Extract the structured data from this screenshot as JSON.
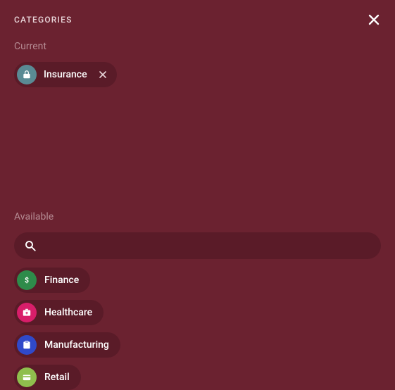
{
  "panel": {
    "title": "CATEGORIES"
  },
  "current": {
    "label": "Current",
    "items": [
      {
        "label": "Insurance",
        "icon": "lock",
        "color": "#5a8a94"
      }
    ]
  },
  "available": {
    "label": "Available",
    "search": {
      "value": "",
      "placeholder": ""
    },
    "items": [
      {
        "label": "Finance",
        "icon": "dollar",
        "color": "#2e8b4a"
      },
      {
        "label": "Healthcare",
        "icon": "medkit",
        "color": "#d81e6a"
      },
      {
        "label": "Manufacturing",
        "icon": "clipboard",
        "color": "#3049c9"
      },
      {
        "label": "Retail",
        "icon": "card",
        "color": "#8fbf4d"
      }
    ]
  },
  "colors": {
    "background": "#6b2230",
    "chip_bg": "#5a1b28",
    "muted_text": "#b58b93"
  }
}
